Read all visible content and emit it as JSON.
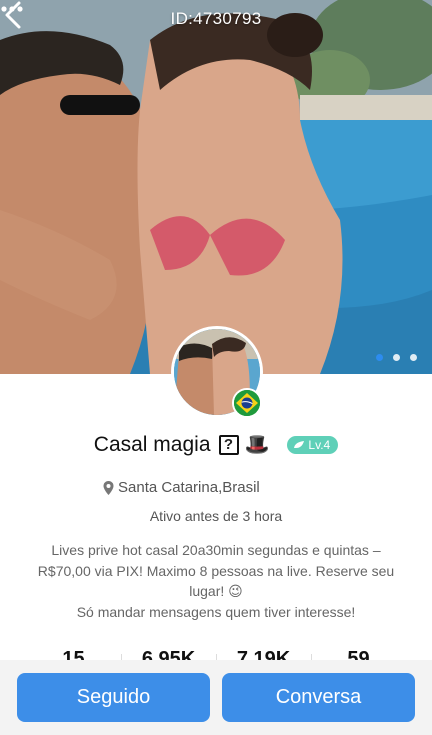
{
  "header": {
    "id_label": "ID:4730793",
    "back_icon": "chevron-left-icon",
    "more_icon": "more-dots-icon"
  },
  "gallery": {
    "page_count": 3,
    "active_index": 0
  },
  "profile": {
    "name": "Casal magia",
    "name_badges": [
      "question-box-icon",
      "top-hat-icon"
    ],
    "level": "Lv.4",
    "country_flag": "brazil-flag-icon",
    "location": "Santa Catarina,Brasil",
    "active_status": "Ativo antes de 3 hora",
    "bio_line_1": "Lives prive hot casal 20a30min segundas e quintas –",
    "bio_line_2": "R$70,00 via PIX! Maximo 8 pessoas na live. Reserve seu",
    "bio_line_3": "lugar! 😉",
    "bio_line_4": "Só mandar mensagens quem tiver interesse!"
  },
  "stats": {
    "values": [
      "15",
      "6.95K",
      "7.19K",
      "59"
    ]
  },
  "actions": {
    "follow_label": "Seguido",
    "chat_label": "Conversa"
  },
  "colors": {
    "accent": "#3d8ee8",
    "level_badge": "#5fd0b8",
    "dot_active": "#2d8cf0"
  }
}
